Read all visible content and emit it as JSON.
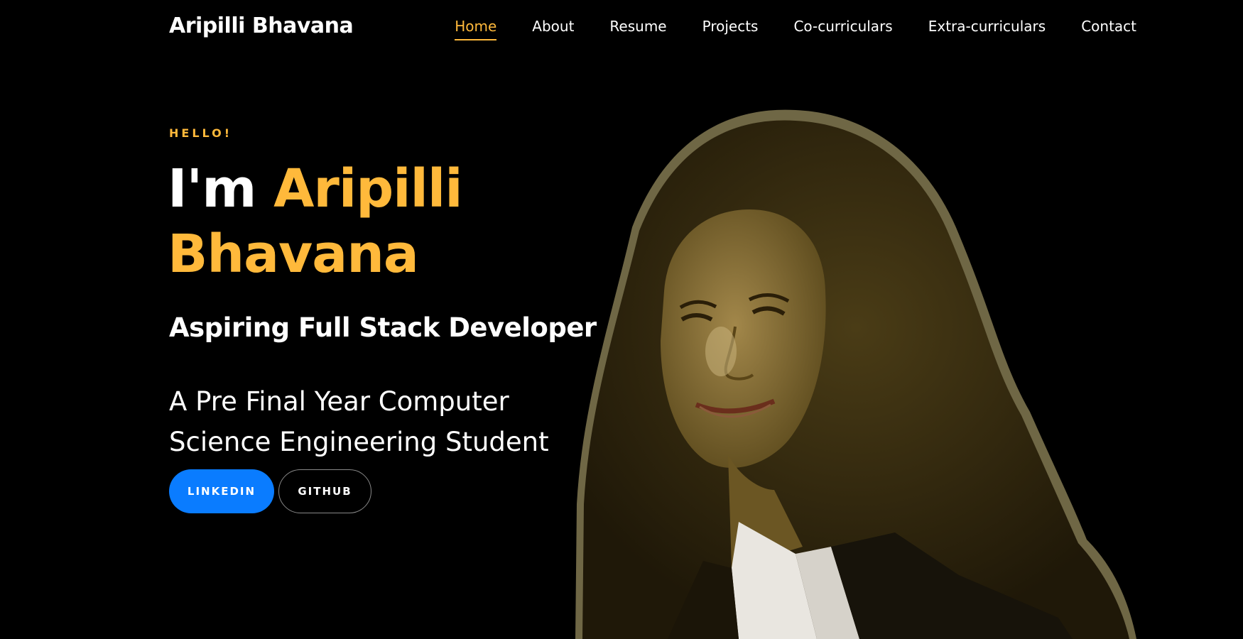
{
  "brand": "Aripilli Bhavana",
  "nav": {
    "items": [
      "Home",
      "About",
      "Resume",
      "Projects",
      "Co-curriculars",
      "Extra-curriculars",
      "Contact"
    ],
    "active": "Home"
  },
  "hero": {
    "greeting": "HELLO!",
    "intro_prefix": "I'm ",
    "name_line1": "Aripilli",
    "name_line2": "Bhavana",
    "role": "Aspiring Full Stack Developer",
    "description": "A Pre Final Year Computer Science Engineering Student",
    "buttons": {
      "linkedin": "LINKEDIN",
      "github": "GITHUB"
    }
  },
  "colors": {
    "accent": "#ffb93b",
    "linkedin": "#0a7cff",
    "background": "#000000"
  }
}
